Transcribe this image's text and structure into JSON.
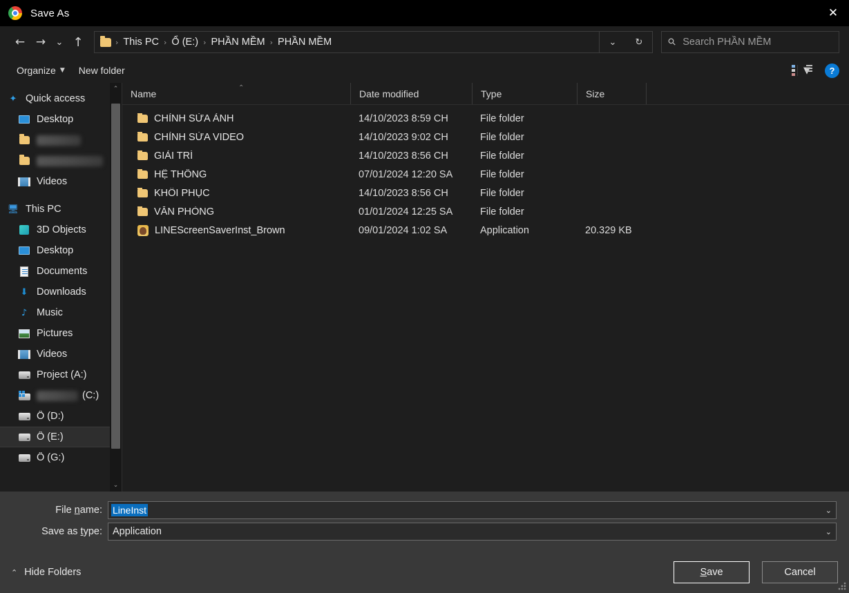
{
  "window": {
    "title": "Save As",
    "app_icon": "chrome-icon",
    "close_label": "✕"
  },
  "nav": {
    "back": "←",
    "forward": "→",
    "recent": "⌄",
    "up": "↑",
    "refresh": "↻",
    "dropdown": "⌄",
    "breadcrumbs": [
      "This PC",
      "Ổ (E:)",
      "PHẦN MỀM",
      "PHẦN MỀM"
    ],
    "separator": "›"
  },
  "search": {
    "placeholder": "Search PHẦN MỀM",
    "icon": "search-icon"
  },
  "toolbar": {
    "organize": "Organize",
    "organize_caret": "▼",
    "new_folder": "New folder",
    "view_caret": "▼",
    "help": "?"
  },
  "sidebar": {
    "scroll_up": "⌃",
    "scroll_down": "⌄",
    "items": [
      {
        "label": "Quick access",
        "icon": "star-icon",
        "indent": 0,
        "selected": false,
        "blurred": false
      },
      {
        "label": "Desktop",
        "icon": "monitor-icon",
        "indent": 1,
        "selected": false,
        "blurred": false
      },
      {
        "label": "",
        "icon": "folder-icon",
        "indent": 1,
        "selected": false,
        "blurred": true,
        "blur_width": 64
      },
      {
        "label": "",
        "icon": "folder-icon",
        "indent": 1,
        "selected": false,
        "blurred": true,
        "blur_width": 96
      },
      {
        "label": "Videos",
        "icon": "video-icon",
        "indent": 1,
        "selected": false,
        "blurred": false
      },
      {
        "label": "This PC",
        "icon": "pc-icon",
        "indent": 0,
        "selected": false,
        "blurred": false
      },
      {
        "label": "3D Objects",
        "icon": "cube-icon",
        "indent": 1,
        "selected": false,
        "blurred": false
      },
      {
        "label": "Desktop",
        "icon": "monitor-icon",
        "indent": 1,
        "selected": false,
        "blurred": false
      },
      {
        "label": "Documents",
        "icon": "document-icon",
        "indent": 1,
        "selected": false,
        "blurred": false
      },
      {
        "label": "Downloads",
        "icon": "download-icon",
        "indent": 1,
        "selected": false,
        "blurred": false
      },
      {
        "label": "Music",
        "icon": "music-icon",
        "indent": 1,
        "selected": false,
        "blurred": false
      },
      {
        "label": "Pictures",
        "icon": "picture-icon",
        "indent": 1,
        "selected": false,
        "blurred": false
      },
      {
        "label": "Videos",
        "icon": "video-icon",
        "indent": 1,
        "selected": false,
        "blurred": false
      },
      {
        "label": "Project (A:)",
        "icon": "drive-icon",
        "indent": 1,
        "selected": false,
        "blurred": false
      },
      {
        "label": "(C:)",
        "icon": "windows-drive-icon",
        "indent": 1,
        "selected": false,
        "blurred": true,
        "blur_width": 64,
        "suffix": "(C:)"
      },
      {
        "label": "Ổ (D:)",
        "icon": "drive-icon",
        "indent": 1,
        "selected": false,
        "blurred": false
      },
      {
        "label": "Ổ (E:)",
        "icon": "drive-icon",
        "indent": 1,
        "selected": true,
        "blurred": false
      },
      {
        "label": "Ổ (G:)",
        "icon": "drive-icon",
        "indent": 1,
        "selected": false,
        "blurred": false
      }
    ]
  },
  "filelist": {
    "columns": [
      "Name",
      "Date modified",
      "Type",
      "Size"
    ],
    "sort_column": "Name",
    "sort_caret": "⌃",
    "rows": [
      {
        "name": "CHỈNH SỬA ẢNH",
        "date": "14/10/2023 8:59 CH",
        "type": "File folder",
        "size": "",
        "icon": "folder-icon"
      },
      {
        "name": "CHỈNH SỬA VIDEO",
        "date": "14/10/2023 9:02 CH",
        "type": "File folder",
        "size": "",
        "icon": "folder-icon"
      },
      {
        "name": "GIẢI TRÍ",
        "date": "14/10/2023 8:56 CH",
        "type": "File folder",
        "size": "",
        "icon": "folder-icon"
      },
      {
        "name": "HỆ THỐNG",
        "date": "07/01/2024 12:20 SA",
        "type": "File folder",
        "size": "",
        "icon": "folder-icon"
      },
      {
        "name": "KHÔI PHỤC",
        "date": "14/10/2023 8:56 CH",
        "type": "File folder",
        "size": "",
        "icon": "folder-icon"
      },
      {
        "name": "VĂN PHÒNG",
        "date": "01/01/2024 12:25 SA",
        "type": "File folder",
        "size": "",
        "icon": "folder-icon"
      },
      {
        "name": "LINEScreenSaverInst_Brown",
        "date": "09/01/2024 1:02 SA",
        "type": "Application",
        "size": "20.329 KB",
        "icon": "line-app-icon"
      }
    ]
  },
  "bottom": {
    "filename_label_pre": "File ",
    "filename_label_accel": "n",
    "filename_label_post": "ame:",
    "filename_value": "LineInst",
    "filetype_label_pre": "Save as ",
    "filetype_label_accel": "t",
    "filetype_label_post": "ype:",
    "filetype_value": "Application",
    "combo_arrow": "⌄",
    "hide_folders": "Hide Folders",
    "hide_folders_caret": "⌃",
    "save_accel": "S",
    "save_rest": "ave",
    "cancel": "Cancel"
  },
  "colors": {
    "titlebar_bg": "#000000",
    "window_bg": "#1e1e1e",
    "panel_bg": "#393939",
    "selection_blue": "#0a6ebd",
    "folder_yellow": "#f0c674",
    "help_blue": "#0a7bd6"
  }
}
